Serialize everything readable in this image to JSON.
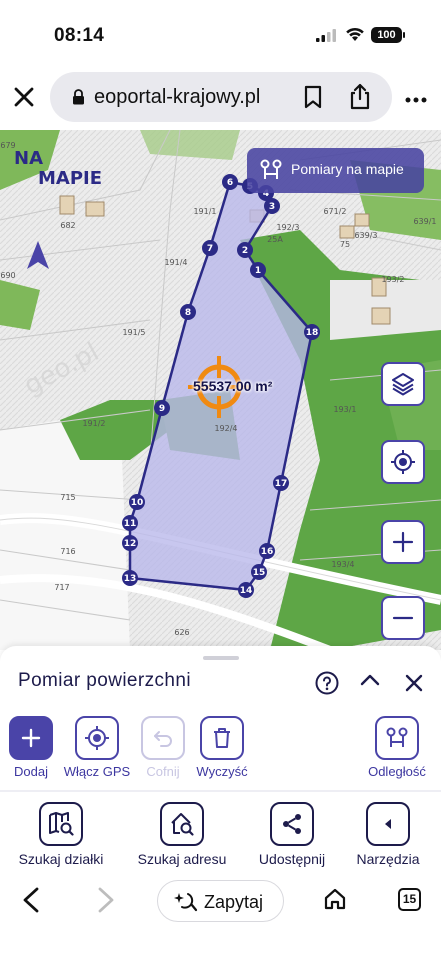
{
  "status_bar": {
    "time": "08:14",
    "battery": "100"
  },
  "browser": {
    "url": "eoportal-krajowy.pl",
    "close_icon": "close-icon",
    "lock_icon": "lock-icon",
    "bookmark_icon": "bookmark-icon",
    "share_icon": "share-icon",
    "more_icon": "more-icon"
  },
  "map": {
    "logo_text_top": "NA",
    "logo_text_bottom": "MAPIE",
    "measure_button_label": "Pomiary na mapie",
    "area_label": "55537.00 m²",
    "vertex_labels": [
      "1",
      "2",
      "3",
      "4",
      "5",
      "6",
      "7",
      "8",
      "9",
      "10",
      "11",
      "12",
      "13",
      "14",
      "15",
      "16",
      "17",
      "18"
    ],
    "parcel_labels": [
      "679",
      "682",
      "690",
      "191/1",
      "191/4",
      "191/5",
      "191/2",
      "192/4",
      "192/3",
      "25A",
      "671/2",
      "639/3",
      "639/1",
      "75",
      "193/2",
      "193/1",
      "193/4",
      "715",
      "716",
      "717",
      "626"
    ],
    "watermark": "geo.pl",
    "accent_color": "#4a44a8",
    "polygon_fill": "#b9b7ea"
  },
  "panel": {
    "title": "Pomiar powierzchni",
    "tools": {
      "add": "Dodaj",
      "gps": "Włącz GPS",
      "undo": "Cofnij",
      "clear": "Wyczyść",
      "distance": "Odległość"
    },
    "nav": {
      "search_parcel": "Szukaj działki",
      "search_address": "Szukaj adresu",
      "share": "Udostępnij",
      "tools": "Narzędzia"
    }
  },
  "browser_bottom": {
    "ask_label": "Zapytaj",
    "tab_count": "15"
  }
}
